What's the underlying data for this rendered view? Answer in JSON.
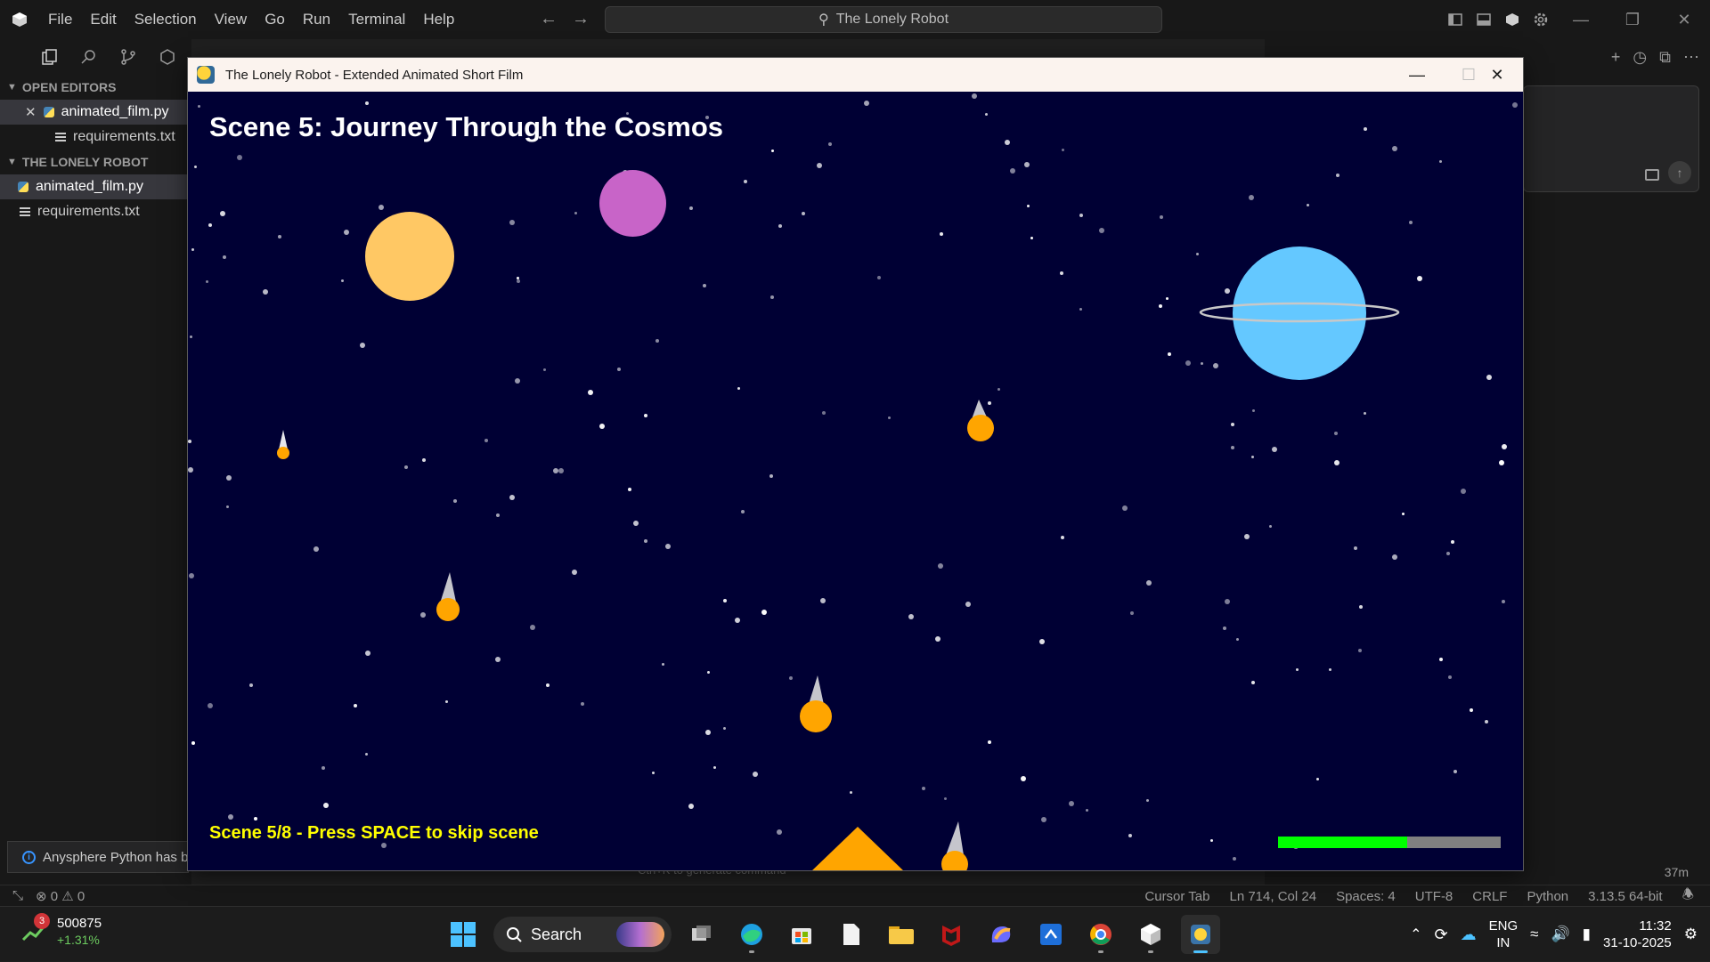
{
  "editor": {
    "menu": [
      "File",
      "Edit",
      "Selection",
      "View",
      "Go",
      "Run",
      "Terminal",
      "Help"
    ],
    "command_center": "The Lonely Robot",
    "sidebar": {
      "sections": [
        {
          "title": "OPEN EDITORS",
          "items": [
            {
              "label": "animated_film.py",
              "icon": "python-file-icon",
              "active": true,
              "closeable": true
            },
            {
              "label": "requirements.txt",
              "icon": "text-file-icon",
              "active": false
            }
          ]
        },
        {
          "title": "THE LONELY ROBOT",
          "items": [
            {
              "label": "animated_film.py",
              "icon": "python-file-icon",
              "active": true
            },
            {
              "label": "requirements.txt",
              "icon": "text-file-icon",
              "active": false
            }
          ]
        }
      ]
    },
    "notification": "Anysphere Python has b",
    "ctrlk_hint": "Ctrl+K to generate command",
    "elapsed": "37m",
    "statusbar": {
      "errors": "0",
      "warnings": "0",
      "right": [
        "Cursor Tab",
        "Ln 714, Col 24",
        "Spaces: 4",
        "UTF-8",
        "CRLF",
        "Python",
        "3.13.5 64-bit"
      ]
    }
  },
  "game": {
    "window_title": "The Lonely Robot - Extended Animated Short Film",
    "scene_title": "Scene 5: Journey Through the Cosmos",
    "scene_hint": "Scene 5/8 - Press SPACE to skip scene",
    "progress": 0.58,
    "colors": {
      "background": "#000034",
      "hint": "#ffff00",
      "progress": "#00ff00",
      "planet_sun": "#ffc864",
      "planet_violet": "#c864c8",
      "planet_blue": "#64c8ff",
      "comet": "#ffa500"
    }
  },
  "taskbar": {
    "stock": {
      "value": "500875",
      "change": "+1.31%",
      "badge": "3"
    },
    "search": "Search",
    "apps": [
      "task-view-icon",
      "edge-browser-icon",
      "microsoft-store-icon",
      "notepad-icon",
      "file-explorer-icon",
      "mcafee-icon",
      "copilot-icon",
      "vscode-icon",
      "chrome-icon",
      "cursor-app-icon",
      "python-app-icon"
    ],
    "lang": [
      "ENG",
      "IN"
    ],
    "time": "11:32",
    "date": "31-10-2025"
  }
}
